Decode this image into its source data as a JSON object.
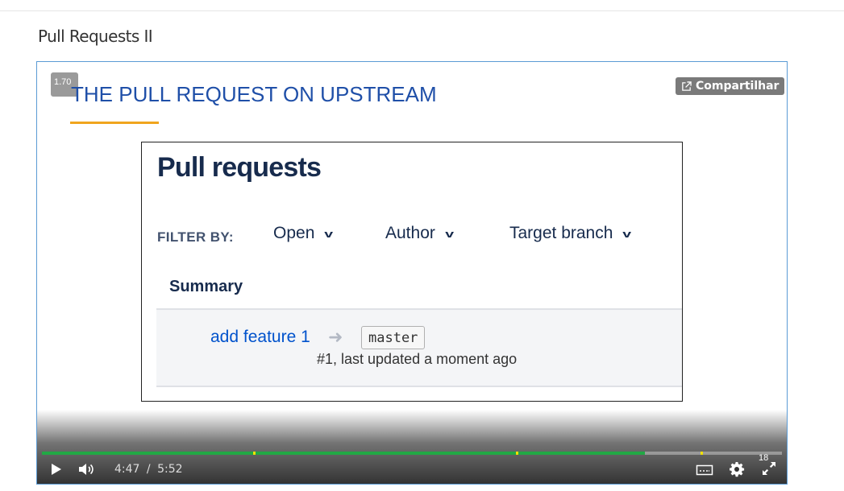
{
  "page": {
    "title": "Pull Requests II"
  },
  "player": {
    "speed_badge": "1.70",
    "share_label": "Compartilhar",
    "slide": {
      "heading": "THE PULL REQUEST ON UPSTREAM",
      "screenshot": {
        "heading": "Pull requests",
        "filter_label": "FILTER BY:",
        "filters": [
          "Open",
          "Author",
          "Target branch"
        ],
        "summary_label": "Summary",
        "pull_request": {
          "title": "add feature 1",
          "target_branch": "master",
          "meta": "#1, last updated a moment ago"
        }
      }
    },
    "controls": {
      "current_time": "4:47",
      "separator": "/",
      "duration": "5:52",
      "progress": 0.815,
      "chapter_marks": [
        0.285,
        0.64,
        0.89
      ],
      "fullscreen_badge": "18"
    },
    "colors": {
      "accent": "#22a845",
      "chapter": "#f0e000",
      "border": "#5b9bd5"
    }
  }
}
